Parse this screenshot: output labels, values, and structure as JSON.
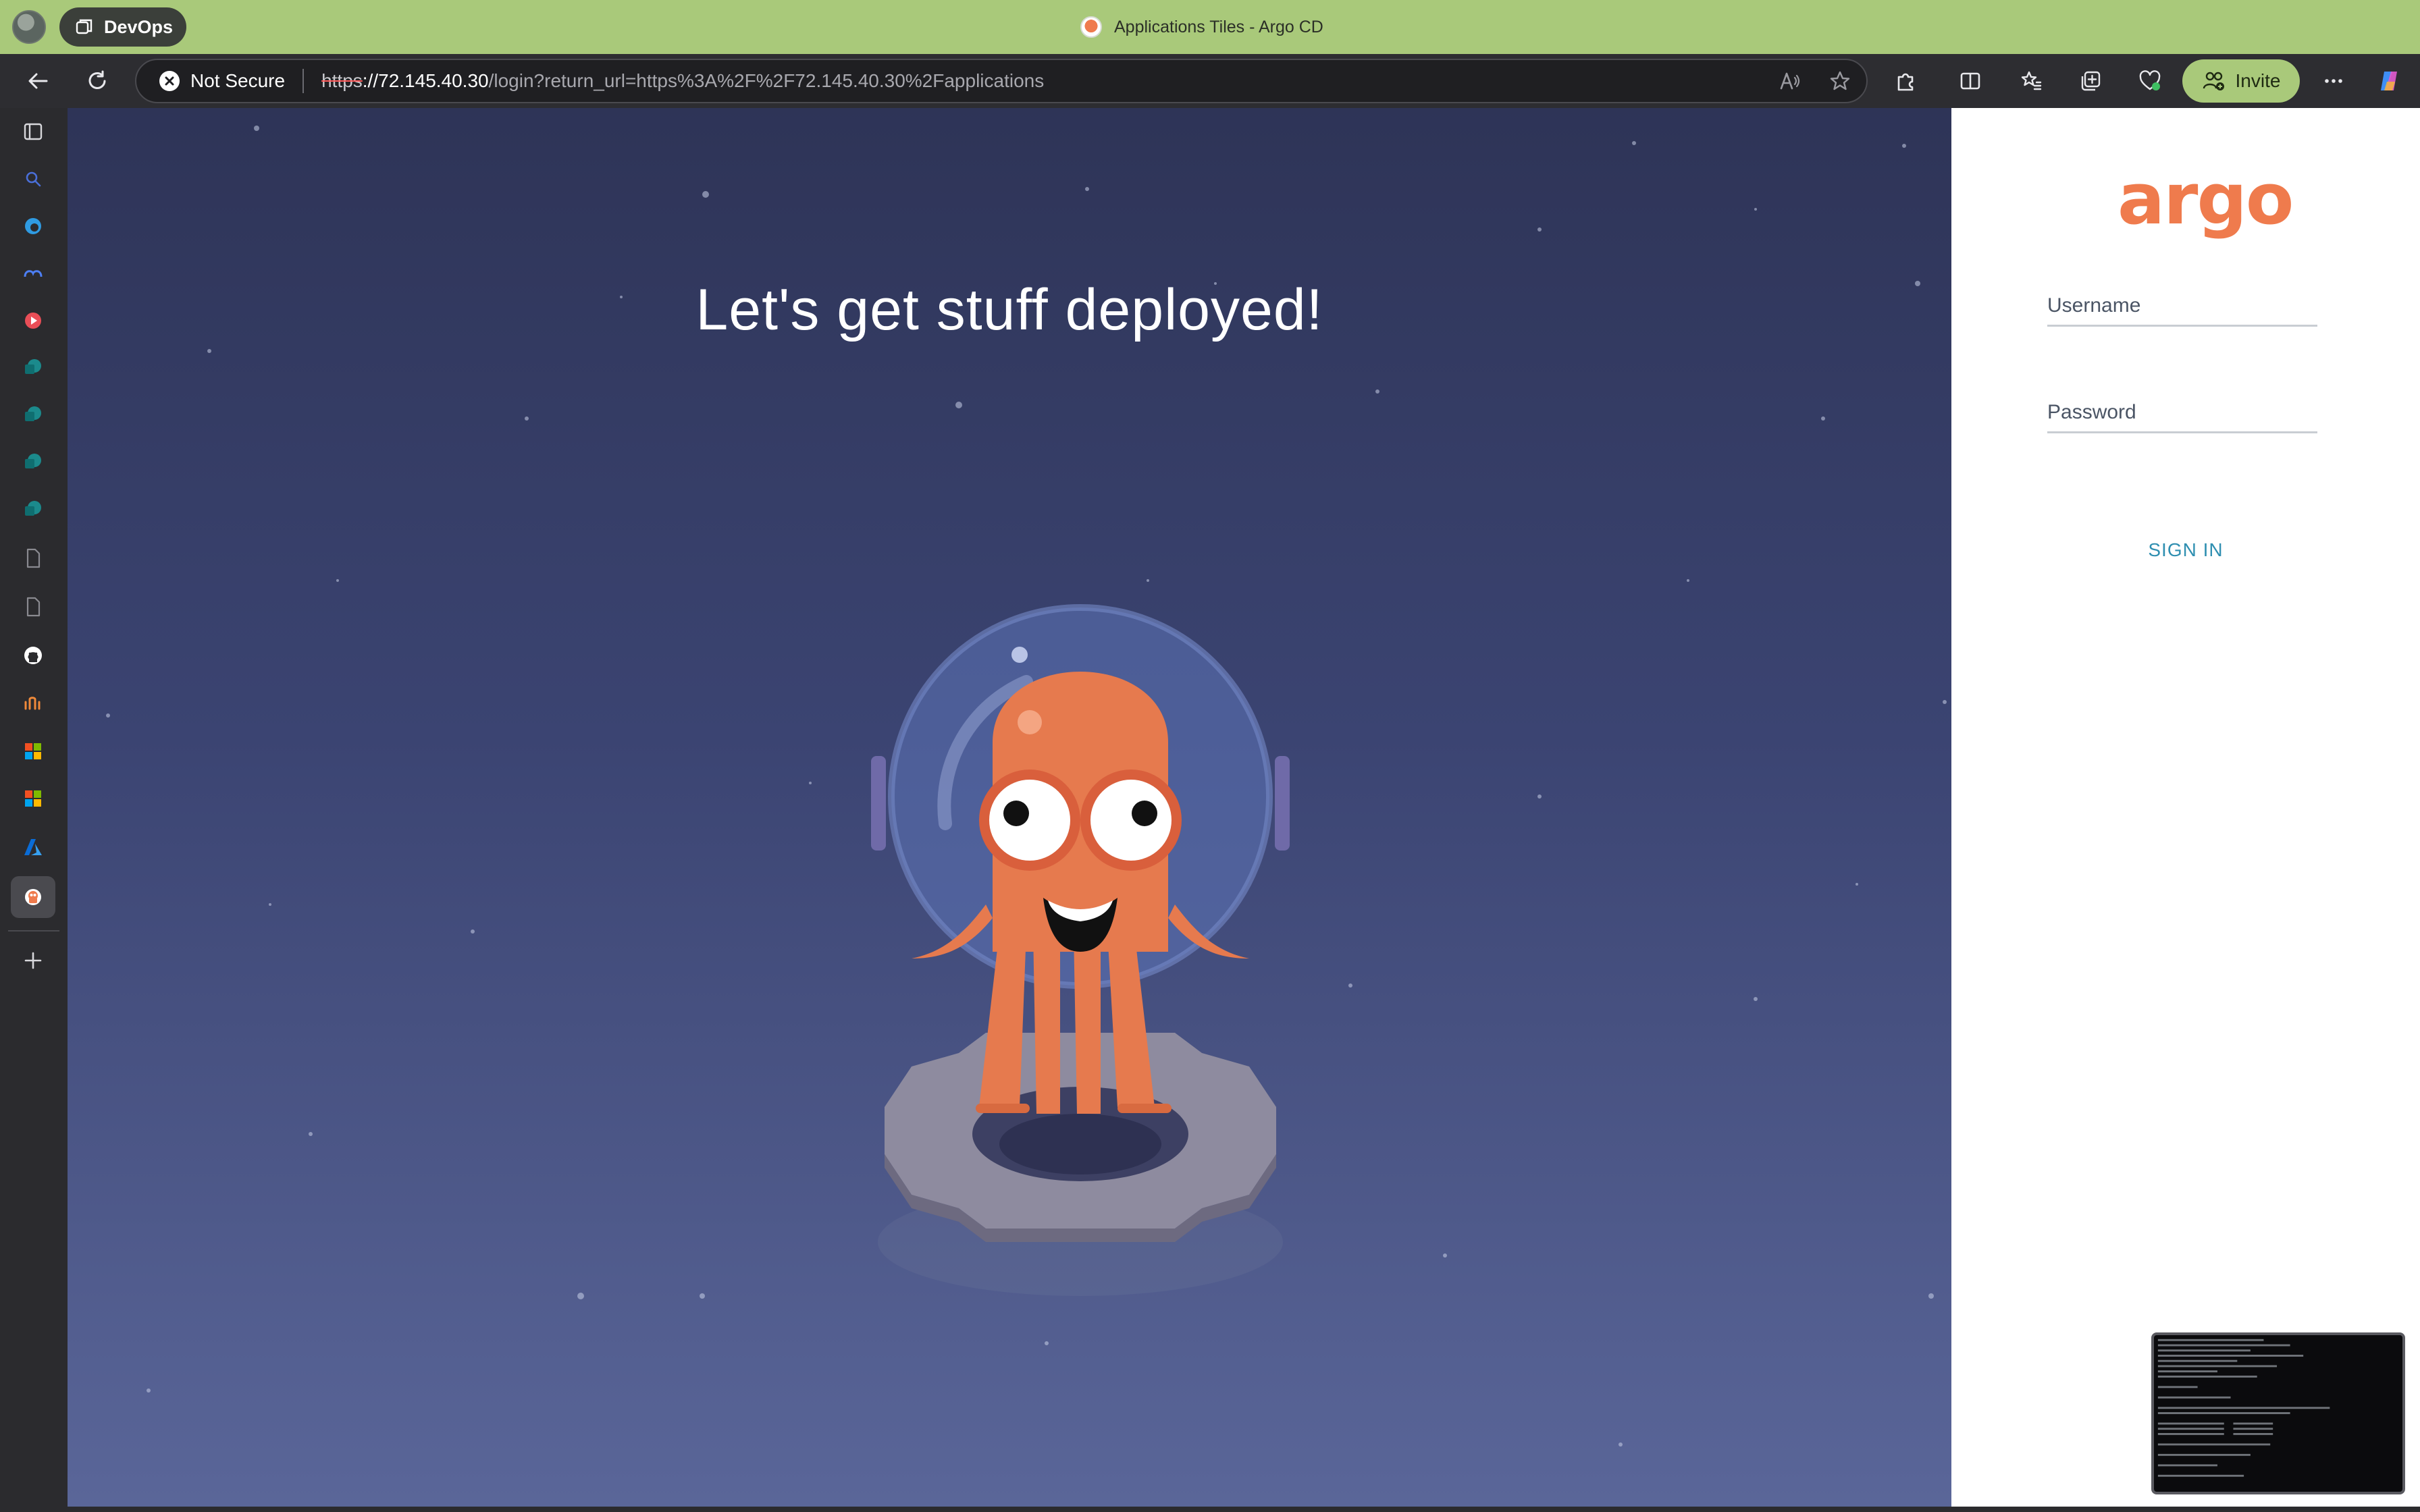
{
  "window": {
    "workspace_label": "DevOps",
    "title": "Applications Tiles - Argo CD"
  },
  "toolbar": {
    "security_label": "Not Secure",
    "url_scheme": "https",
    "url_host": "://72.145.40.30",
    "url_rest": "/login?return_url=https%3A%2F%2F72.145.40.30%2Fapplications",
    "invite_label": "Invite"
  },
  "sidebar": {
    "tabs": [
      "vertical-tabs",
      "search",
      "edge",
      "copilot",
      "youtube",
      "sharepoint",
      "sharepoint",
      "sharepoint",
      "sharepoint",
      "document",
      "document",
      "github",
      "grafana",
      "microsoft",
      "microsoft",
      "azure",
      "argo-cd"
    ]
  },
  "page": {
    "heading": "Let's get stuff deployed!",
    "logo_text": "argo",
    "username_placeholder": "Username",
    "password_placeholder": "Password",
    "signin_label": "SIGN IN"
  },
  "colors": {
    "accent": "#a9c97a",
    "argo_orange": "#ef7b4d",
    "signin_blue": "#2f8fb1",
    "hero_top": "#2e3457",
    "hero_bottom": "#5a6699"
  }
}
